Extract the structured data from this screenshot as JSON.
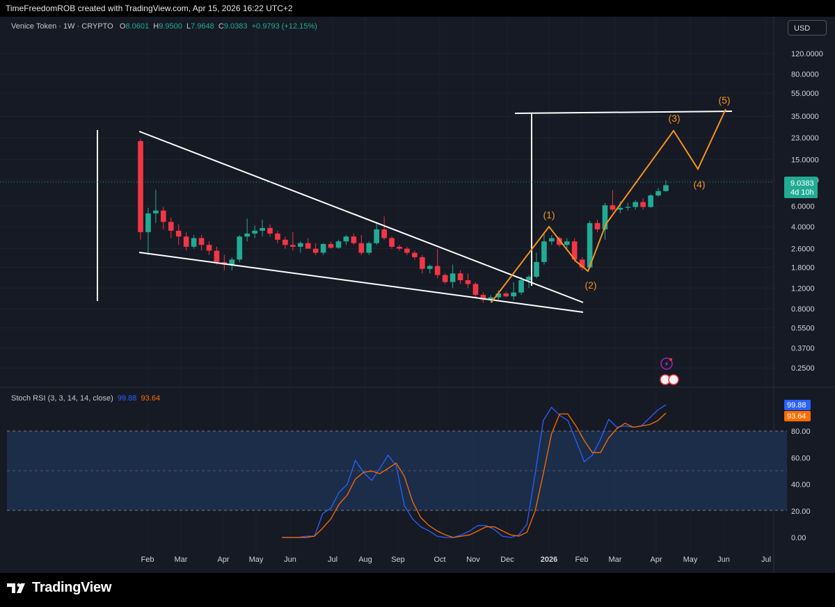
{
  "topbar": {
    "text": "TimeFreedomROB created with TradingView.com, Apr 15, 2026 16:22 UTC+2"
  },
  "header": {
    "symbol": "Venice Token · 1W · CRYPTO",
    "o_label": "O",
    "o": "8.0601",
    "h_label": "H",
    "h": "9.9500",
    "l_label": "L",
    "l": "7.9648",
    "c_label": "C",
    "c": "9.0383",
    "change": "+0.9793 (+12.15%)"
  },
  "currency_button": "USD",
  "price_tag": {
    "price": "9.0383",
    "countdown": "4d 10h"
  },
  "indicator": {
    "title": "Stoch RSI (3, 3, 14, 14, close)",
    "k_value": "99.88",
    "d_value": "93.64"
  },
  "logo": {
    "text": "TradingView"
  },
  "colors": {
    "background": "#161a25",
    "up": "#22ab94",
    "down": "#f23645",
    "k_line": "#2962ff",
    "d_line": "#ff6d00",
    "wave": "#f7931a",
    "drawing": "#ffffff"
  },
  "chart_data": [
    {
      "type": "candlestick",
      "title": "Venice Token · 1W · CRYPTO",
      "scale": "log",
      "currency": "USD",
      "ylim": [
        0.2,
        150
      ],
      "y_ticks": [
        "120.0000",
        "80.0000",
        "55.0000",
        "35.0000",
        "23.0000",
        "15.0000",
        "10.0000",
        "6.0000",
        "4.0000",
        "2.6000",
        "1.8000",
        "1.2000",
        "0.8000",
        "0.5500",
        "0.3700",
        "0.2500"
      ],
      "x_ticks": [
        "Feb",
        "Mar",
        "Apr",
        "May",
        "Jun",
        "Jul",
        "Aug",
        "Sep",
        "Oct",
        "Nov",
        "Dec",
        "2026",
        "Feb",
        "Mar",
        "Apr",
        "May",
        "Jun",
        "Jul"
      ],
      "candles_ohlc": [
        [
          21.5,
          22.5,
          3.1,
          3.6
        ],
        [
          3.6,
          5.8,
          2.3,
          5.2
        ],
        [
          5.2,
          8.3,
          4.3,
          5.5
        ],
        [
          5.5,
          5.9,
          3.8,
          4.4
        ],
        [
          4.4,
          4.8,
          3.2,
          3.7
        ],
        [
          3.7,
          4.2,
          2.8,
          3.3
        ],
        [
          3.3,
          3.6,
          2.5,
          2.7
        ],
        [
          2.7,
          3.4,
          2.6,
          3.2
        ],
        [
          3.2,
          3.4,
          2.5,
          2.8
        ],
        [
          2.8,
          3.0,
          2.3,
          2.5
        ],
        [
          2.5,
          2.7,
          1.9,
          2.0
        ],
        [
          2.0,
          2.3,
          1.7,
          1.9
        ],
        [
          1.9,
          2.2,
          1.7,
          2.1
        ],
        [
          2.1,
          3.4,
          2.0,
          3.3
        ],
        [
          3.3,
          4.7,
          3.0,
          3.5
        ],
        [
          3.5,
          4.1,
          3.2,
          3.7
        ],
        [
          3.7,
          4.6,
          3.3,
          3.9
        ],
        [
          3.9,
          4.2,
          3.3,
          3.5
        ],
        [
          3.5,
          3.7,
          2.9,
          3.1
        ],
        [
          3.1,
          3.3,
          2.6,
          2.8
        ],
        [
          2.8,
          3.6,
          2.5,
          2.7
        ],
        [
          2.7,
          3.0,
          2.4,
          2.9
        ],
        [
          2.9,
          3.2,
          2.7,
          2.6
        ],
        [
          2.6,
          2.9,
          2.3,
          2.4
        ],
        [
          2.4,
          2.9,
          2.3,
          2.85
        ],
        [
          2.85,
          3.0,
          2.6,
          2.65
        ],
        [
          2.65,
          3.1,
          2.6,
          3.0
        ],
        [
          3.0,
          3.4,
          2.8,
          3.3
        ],
        [
          3.3,
          3.5,
          2.8,
          2.9
        ],
        [
          2.9,
          3.4,
          2.3,
          2.4
        ],
        [
          2.4,
          3.0,
          2.3,
          2.9
        ],
        [
          2.9,
          4.3,
          2.8,
          3.8
        ],
        [
          3.8,
          4.9,
          3.1,
          3.2
        ],
        [
          3.2,
          3.3,
          2.6,
          2.7
        ],
        [
          2.7,
          2.8,
          2.5,
          2.6
        ],
        [
          2.6,
          2.7,
          2.3,
          2.4
        ],
        [
          2.4,
          2.5,
          2.1,
          2.2
        ],
        [
          2.2,
          2.3,
          1.6,
          1.75
        ],
        [
          1.75,
          1.9,
          1.6,
          1.85
        ],
        [
          1.85,
          2.6,
          1.45,
          1.55
        ],
        [
          1.55,
          1.6,
          1.3,
          1.35
        ],
        [
          1.35,
          1.9,
          1.2,
          1.6
        ],
        [
          1.6,
          1.7,
          1.3,
          1.4
        ],
        [
          1.4,
          1.6,
          1.2,
          1.3
        ],
        [
          1.3,
          1.35,
          1.0,
          1.05
        ],
        [
          1.05,
          1.1,
          0.9,
          0.95
        ],
        [
          0.95,
          1.05,
          0.9,
          1.0
        ],
        [
          1.0,
          1.15,
          0.95,
          1.08
        ],
        [
          1.08,
          1.12,
          1.0,
          1.02
        ],
        [
          1.02,
          1.35,
          0.95,
          1.1
        ],
        [
          1.1,
          1.5,
          1.05,
          1.4
        ],
        [
          1.4,
          1.55,
          1.2,
          1.5
        ],
        [
          1.5,
          2.4,
          1.45,
          2.0
        ],
        [
          2.0,
          3.6,
          1.9,
          3.0
        ],
        [
          3.0,
          3.4,
          2.8,
          3.2
        ],
        [
          3.2,
          3.3,
          2.7,
          2.8
        ],
        [
          2.8,
          3.2,
          2.6,
          3.0
        ],
        [
          3.0,
          3.2,
          2.0,
          2.1
        ],
        [
          2.1,
          2.2,
          1.7,
          1.8
        ],
        [
          1.8,
          4.5,
          1.75,
          4.3
        ],
        [
          4.3,
          4.6,
          3.6,
          3.8
        ],
        [
          3.8,
          6.4,
          3.1,
          6.1
        ],
        [
          6.1,
          8.2,
          5.4,
          5.6
        ],
        [
          5.6,
          6.6,
          5.2,
          5.8
        ],
        [
          5.8,
          6.4,
          5.5,
          5.9
        ],
        [
          5.9,
          6.7,
          5.6,
          6.5
        ],
        [
          6.5,
          7.0,
          5.6,
          5.9
        ],
        [
          5.9,
          7.6,
          5.8,
          7.4
        ],
        [
          7.4,
          8.6,
          7.2,
          8.06
        ],
        [
          8.06,
          9.95,
          7.9648,
          9.0383
        ]
      ]
    },
    {
      "type": "line",
      "title": "Stoch RSI (3, 3, 14, 14, close)",
      "ylim": [
        0,
        100
      ],
      "y_ticks": [
        "80.00",
        "60.00",
        "40.00",
        "20.00",
        "0.00"
      ],
      "series": [
        {
          "name": "K",
          "values": [
            0,
            0,
            0,
            1,
            1,
            18,
            22,
            34,
            40,
            58,
            49,
            43,
            52,
            62,
            54,
            24,
            14,
            8,
            5,
            1,
            0,
            0,
            2,
            5,
            9,
            9,
            6,
            1,
            0,
            2,
            10,
            48,
            88,
            98,
            92,
            88,
            73,
            57,
            62,
            74,
            89,
            83,
            84,
            83,
            84,
            90,
            96,
            99.88
          ]
        },
        {
          "name": "D",
          "values": [
            0,
            0,
            0,
            0,
            1,
            7,
            14,
            25,
            32,
            44,
            49,
            50,
            48,
            52,
            56,
            46,
            27,
            15,
            9,
            5,
            2,
            0,
            1,
            2,
            5,
            8,
            8,
            5,
            2,
            1,
            4,
            20,
            48,
            78,
            93,
            93,
            84,
            73,
            64,
            64,
            75,
            82,
            86,
            83,
            84,
            85,
            88,
            93.64
          ]
        }
      ]
    }
  ]
}
